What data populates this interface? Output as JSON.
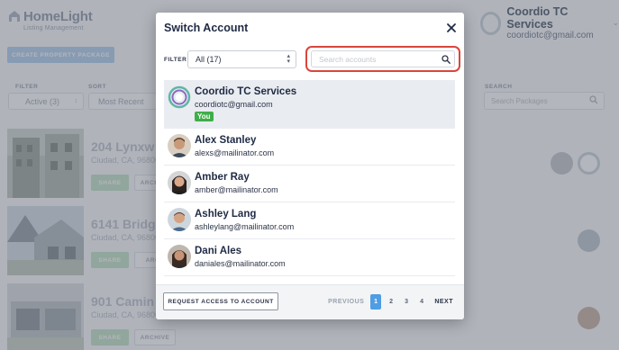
{
  "background": {
    "logo": {
      "name": "HomeLight",
      "sub": "Listing Management"
    },
    "create_button": "CREATE PROPERTY PACKAGE",
    "filter_label": "FILTER",
    "filter_value": "Active (3)",
    "sort_label": "SORT",
    "sort_value": "Most Recent",
    "search_label": "SEARCH",
    "search_placeholder": "Search Packages",
    "account": {
      "name": "Coordio TC Services",
      "email": "coordiotc@gmail.com"
    },
    "properties": [
      {
        "address": "204 Lynxw",
        "city": "Ciudad, CA, 96800",
        "share": "SHARE",
        "archive": "ARCHIVE"
      },
      {
        "address": "6141 Bridg",
        "city": "Ciudad, CA, 96800",
        "share": "SHARE",
        "archive": "ARCH"
      },
      {
        "address": "901 Camin",
        "city": "Ciudad, CA, 96800",
        "share": "SHARE",
        "archive": "ARCHIVE"
      }
    ]
  },
  "modal": {
    "title": "Switch Account",
    "filter_label": "FILTER",
    "filter_value": "All (17)",
    "search_placeholder": "Search accounts",
    "accounts": [
      {
        "name": "Coordio TC Services",
        "email": "coordiotc@gmail.com",
        "badge": "You",
        "avatar": "coordio-logo"
      },
      {
        "name": "Alex Stanley",
        "email": "alexs@mailinator.com",
        "avatar": "photo-alex"
      },
      {
        "name": "Amber Ray",
        "email": "amber@mailinator.com",
        "avatar": "photo-amber"
      },
      {
        "name": "Ashley Lang",
        "email": "ashleylang@mailinator.com",
        "avatar": "photo-ashley"
      },
      {
        "name": "Dani Ales",
        "email": "daniales@mailinator.com",
        "avatar": "photo-dani"
      }
    ],
    "request_button": "REQUEST ACCESS TO ACCOUNT",
    "pagination": {
      "previous": "PREVIOUS",
      "pages": [
        "1",
        "2",
        "3",
        "4"
      ],
      "current": "1",
      "next": "NEXT"
    }
  },
  "colors": {
    "accent": "#4f9de4",
    "highlight_border": "#d9463b",
    "badge_green": "#3fae49"
  }
}
